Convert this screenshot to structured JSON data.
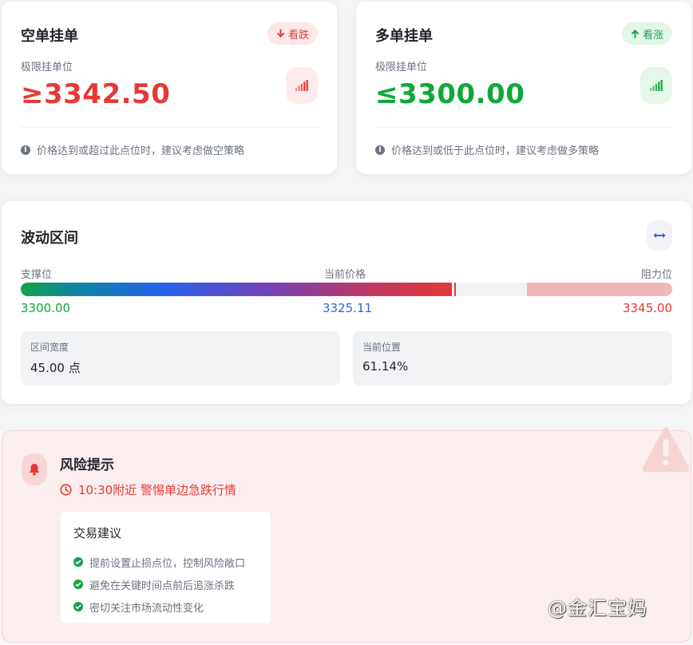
{
  "short_order": {
    "title": "空单挂单",
    "badge": "看跌",
    "sub_label": "极限挂单位",
    "value": "≥3342.50",
    "note": "价格达到或超过此点位时，建议考虑做空策略",
    "accent_color": "#e53935"
  },
  "long_order": {
    "title": "多单挂单",
    "badge": "看涨",
    "sub_label": "极限挂单位",
    "value": "≤3300.00",
    "note": "价格达到或低于此点位时，建议考虑做多策略",
    "accent_color": "#0ea836"
  },
  "range": {
    "title": "波动区间",
    "support_label": "支撑位",
    "current_label": "当前价格",
    "resistance_label": "阻力位",
    "support_value": "3300.00",
    "current_value": "3325.11",
    "resistance_value": "3345.00",
    "position_fraction": 0.667,
    "resistance_zone_start_fraction": 0.777,
    "width_label": "区间宽度",
    "width_value": "45.00 点",
    "position_label": "当前位置",
    "position_value": "61.14%"
  },
  "risk": {
    "title": "风险提示",
    "time_note": "10:30附近 警惕单边急跌行情",
    "advice_title": "交易建议",
    "advice_items": [
      "提前设置止损点位，控制风险敞口",
      "避免在关键时间点前后追涨杀跌",
      "密切关注市场流动性变化"
    ]
  },
  "watermark": "@金汇宝妈",
  "icons": {
    "down-arrow": "down-arrow-icon",
    "up-arrow": "up-arrow-icon",
    "signal": "signal-icon",
    "info": "info-icon",
    "swap": "swap-horizontal-icon",
    "bell": "bell-icon",
    "clock": "clock-icon",
    "check": "check-circle-icon",
    "warning": "warning-icon"
  }
}
